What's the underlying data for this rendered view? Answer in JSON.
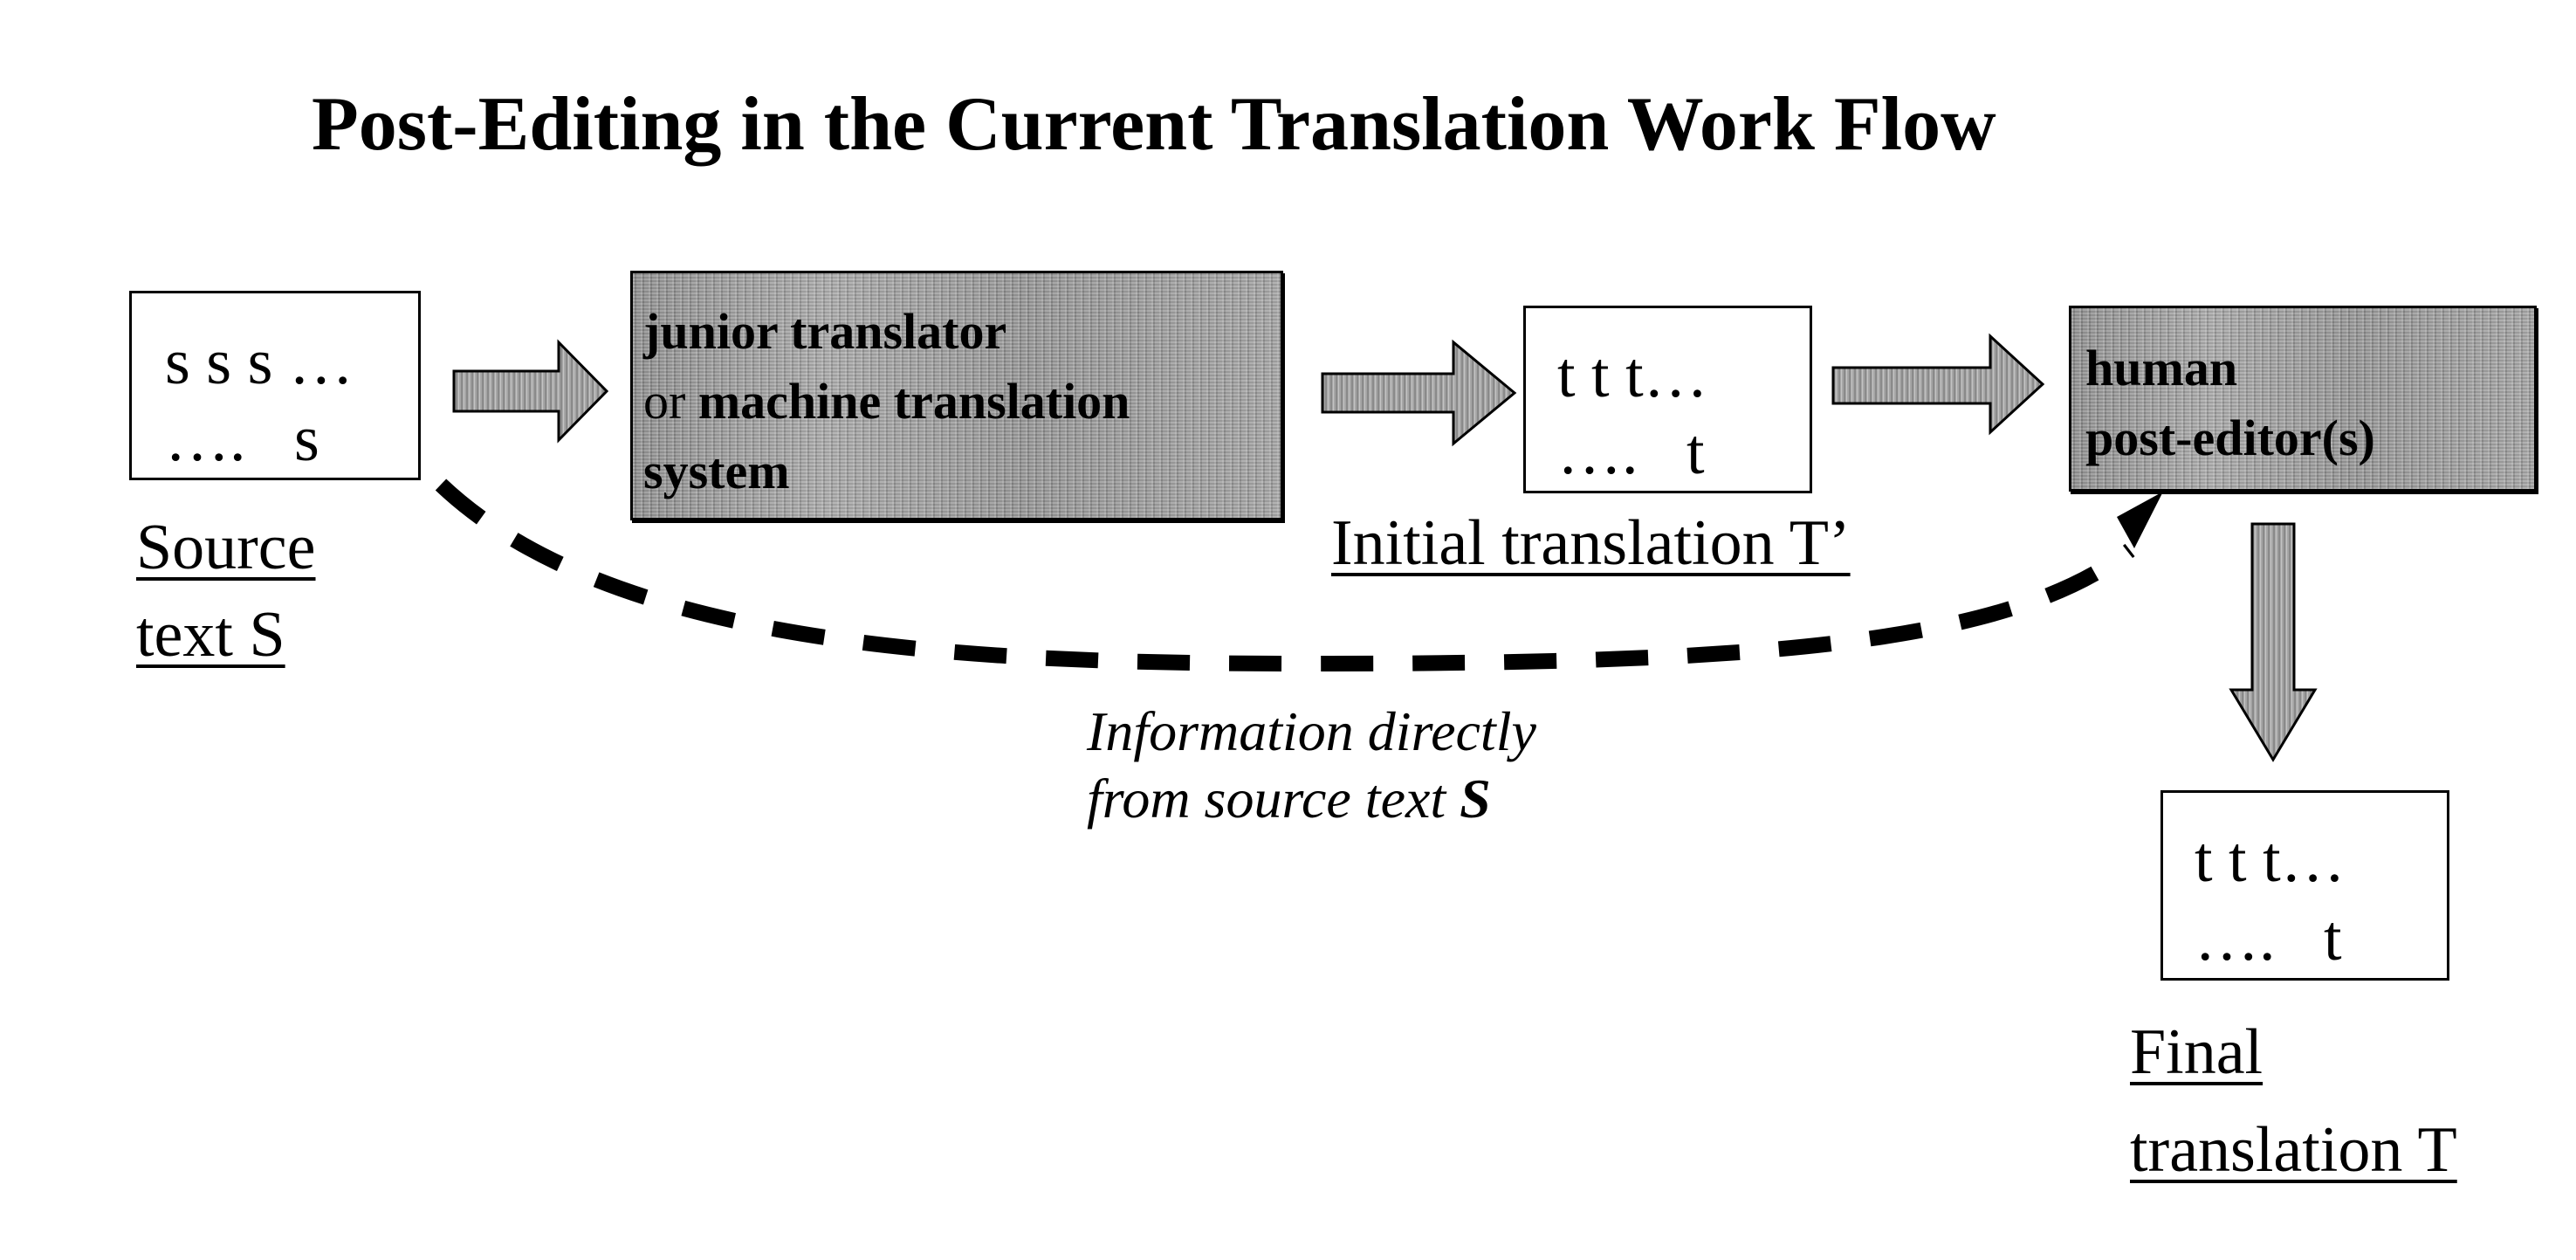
{
  "title": "Post-Editing in the Current Translation Work Flow",
  "source": {
    "box_line1": "s s s …",
    "box_line2": "….   s",
    "label_line1": "Source",
    "label_line2": "text S"
  },
  "junior": {
    "line1_bold": "junior translator",
    "line2_normal": "or ",
    "line2_bold": "machine translation",
    "line3_bold": "system"
  },
  "initial": {
    "box_line1": "t t t…",
    "box_line2": "….   t",
    "label": "Initial translation T’"
  },
  "human": {
    "line1": "human",
    "line2": "post-editor(s)"
  },
  "final": {
    "box_line1": "t t t…",
    "box_line2": "….   t",
    "label_line1": "Final",
    "label_line2": "translation T"
  },
  "note": {
    "line1": "Information directly",
    "line2_prefix": "from source text ",
    "line2_bold": "S"
  },
  "colors": {
    "ink": "#000000",
    "shade": "#9a9a9a",
    "background": "#ffffff"
  }
}
